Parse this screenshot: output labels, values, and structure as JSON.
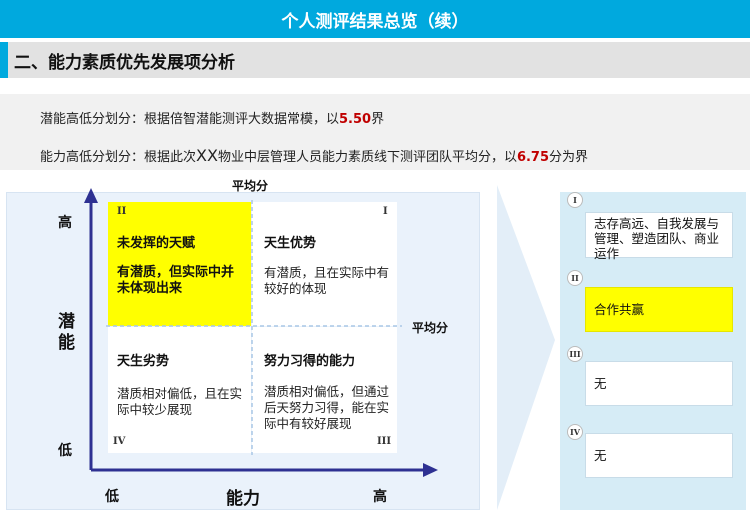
{
  "header": {
    "title": "个人测评结果总览（续）"
  },
  "section": {
    "title": "二、能力素质优先发展项分析"
  },
  "notes": {
    "line1": {
      "prefix": "潜能高低分划分：根据倍智潜能测评大数据常模，以",
      "value": "5.50",
      "suffix": "界"
    },
    "line2": {
      "prefix": "能力高低分划分：根据此次",
      "xx": "XX",
      "middle": "物业中层管理人员能力素质线下测评团队平均分，以",
      "value": "6.75",
      "suffix": "分为界"
    }
  },
  "matrix": {
    "y_axis_label": "潜能",
    "x_axis_label": "能力",
    "y_high": "高",
    "y_low": "低",
    "x_low": "低",
    "x_high": "高",
    "avg_top": "平均分",
    "avg_right": "平均分",
    "quadrants": {
      "II": {
        "numeral": "II",
        "title": "未发挥的天赋",
        "desc": "有潜质，但实际中并未体现出来"
      },
      "I": {
        "numeral": "I",
        "title": "天生优势",
        "desc": "有潜质，且在实际中有较好的体现"
      },
      "IV": {
        "numeral": "IV",
        "title": "天生劣势",
        "desc": "潜质相对偏低，且在实际中较少展现"
      },
      "III": {
        "numeral": "III",
        "title": "努力习得的能力",
        "desc": "潜质相对偏低，但通过后天努力习得，能在实际中有较好展现"
      }
    }
  },
  "results": [
    {
      "numeral": "I",
      "text": "志存高远、自我发展与管理、塑造团队、商业运作"
    },
    {
      "numeral": "II",
      "text": "合作共赢"
    },
    {
      "numeral": "III",
      "text": "无"
    },
    {
      "numeral": "IV",
      "text": "无"
    }
  ],
  "colors": {
    "accent": "#00a9de",
    "highlight": "#ffff00",
    "arrow": "#2e3192",
    "value_red": "#c00000"
  }
}
